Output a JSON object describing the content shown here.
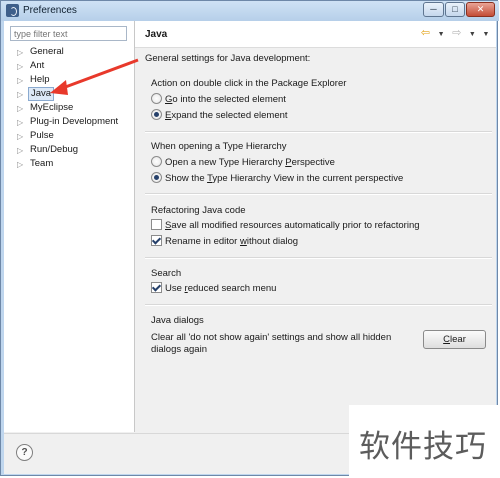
{
  "window": {
    "title": "Preferences",
    "min_label": "─",
    "max_label": "□",
    "close_label": "✕"
  },
  "filter": {
    "placeholder": "type filter text"
  },
  "tree": {
    "items": [
      {
        "label": "General",
        "selected": false
      },
      {
        "label": "Ant",
        "selected": false
      },
      {
        "label": "Help",
        "selected": false
      },
      {
        "label": "Java",
        "selected": true
      },
      {
        "label": "MyEclipse",
        "selected": false
      },
      {
        "label": "Plug-in Development",
        "selected": false
      },
      {
        "label": "Pulse",
        "selected": false
      },
      {
        "label": "Run/Debug",
        "selected": false
      },
      {
        "label": "Team",
        "selected": false
      }
    ],
    "expander_glyph": "▷"
  },
  "page": {
    "title": "Java",
    "description": "General settings for Java development:",
    "nav": {
      "back_icon": "back-arrow-icon",
      "forward_icon": "forward-arrow-icon",
      "dropdown": "▼",
      "menu": "▼"
    }
  },
  "groups": {
    "double_click": {
      "title": "Action on double click in the Package Explorer",
      "opt1": {
        "pre": "",
        "mn": "G",
        "post": "o into the selected element",
        "checked": false
      },
      "opt2": {
        "pre": "",
        "mn": "E",
        "post": "xpand the selected element",
        "checked": true
      }
    },
    "hierarchy": {
      "title": "When opening a Type Hierarchy",
      "opt1": {
        "pre": "Open a new Type Hierarchy ",
        "mn": "P",
        "post": "erspective",
        "checked": false
      },
      "opt2": {
        "pre": "Show the ",
        "mn": "T",
        "post": "ype Hierarchy View in the current perspective",
        "checked": true
      }
    },
    "refactoring": {
      "title": "Refactoring Java code",
      "opt1": {
        "pre": "",
        "mn": "S",
        "post": "ave all modified resources automatically prior to refactoring",
        "checked": false
      },
      "opt2": {
        "pre": "Rename in editor ",
        "mn": "w",
        "post": "ithout dialog",
        "checked": true
      }
    },
    "search": {
      "title": "Search",
      "opt1": {
        "pre": "Use ",
        "mn": "r",
        "post": "educed search menu",
        "checked": true
      }
    },
    "dialogs": {
      "title": "Java dialogs",
      "text": "Clear all 'do not show again' settings and show all hidden dialogs again",
      "clear_pre": "",
      "clear_mn": "C",
      "clear_post": "lear"
    }
  },
  "help": {
    "label": "?"
  },
  "watermark": {
    "text": "软件技巧"
  },
  "colors": {
    "annotation_arrow": "#e8392b",
    "selection": "#dde9f7"
  }
}
